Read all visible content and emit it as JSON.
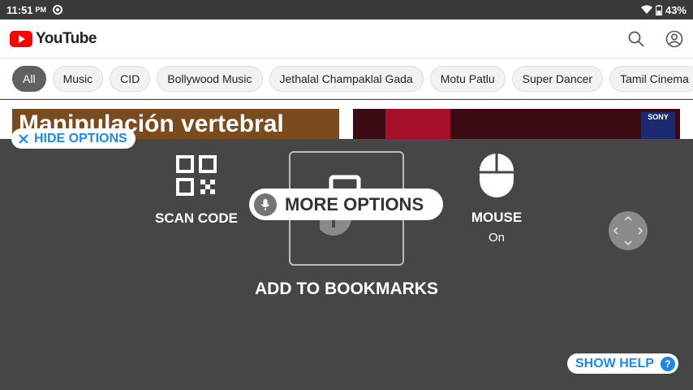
{
  "status_bar": {
    "time": "11:51",
    "ampm": "PM",
    "battery": "43%"
  },
  "youtube": {
    "logo_text": "YouTube",
    "chips": [
      "All",
      "Music",
      "CID",
      "Bollywood Music",
      "Jethalal Champaklal Gada",
      "Motu Patlu",
      "Super Dancer",
      "Tamil Cinema"
    ],
    "active_chip": "All",
    "video1_title_overlay": "Manipulación vertebral",
    "video2_badge": "SONY"
  },
  "overlay": {
    "hide_options": "HIDE OPTIONS",
    "scan_code": "SCAN CODE",
    "more_options": "MORE OPTIONS",
    "add_to_bookmarks": "ADD TO BOOKMARKS",
    "mouse": {
      "label": "MOUSE",
      "state": "On"
    },
    "show_help": "SHOW HELP",
    "help_glyph": "?"
  },
  "colors": {
    "accent": "#1e88e5",
    "youtube_red": "#ff0000",
    "panel_bg": "#464646"
  }
}
